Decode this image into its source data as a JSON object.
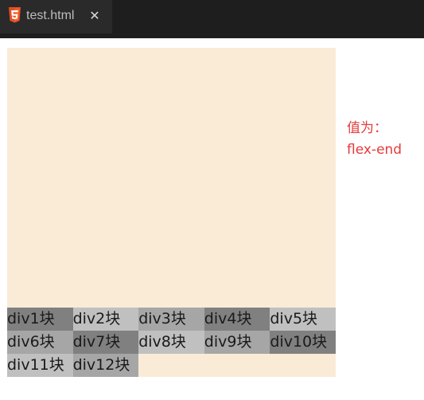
{
  "tab": {
    "title": "test.html",
    "icon": "html5-icon",
    "close_symbol": "✕"
  },
  "demo": {
    "boxes": [
      {
        "label": "div1块",
        "color": "#808080"
      },
      {
        "label": "div2块",
        "color": "#c0c0c0"
      },
      {
        "label": "div3块",
        "color": "#a6a6a6"
      },
      {
        "label": "div4块",
        "color": "#808080"
      },
      {
        "label": "div5块",
        "color": "#c0c0c0"
      },
      {
        "label": "div6块",
        "color": "#a6a6a6"
      },
      {
        "label": "div7块",
        "color": "#808080"
      },
      {
        "label": "div8块",
        "color": "#c0c0c0"
      },
      {
        "label": "div9块",
        "color": "#a6a6a6"
      },
      {
        "label": "div10块",
        "color": "#808080"
      },
      {
        "label": "div11块",
        "color": "#c0c0c0"
      },
      {
        "label": "div12块",
        "color": "#a6a6a6"
      }
    ],
    "container_color": "#faebd7"
  },
  "caption": {
    "line1": "值为：",
    "line2": "flex-end",
    "color": "#e53a3a"
  }
}
